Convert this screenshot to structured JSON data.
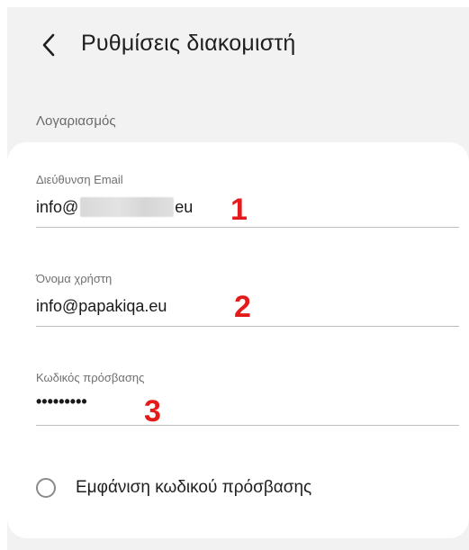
{
  "header": {
    "back_icon": "chevron-left-icon",
    "title": "Ρυθμίσεις διακομιστή"
  },
  "account": {
    "section_label": "Λογαριασμός",
    "email": {
      "label": "Διεύθυνση Email",
      "value_prefix": "info@",
      "value_suffix": "eu",
      "annotation": "1"
    },
    "username": {
      "label": "Όνομα χρήστη",
      "value": "info@papakiqa.eu",
      "annotation": "2"
    },
    "password": {
      "label": "Κωδικός πρόσβασης",
      "value": "•••••••••",
      "annotation": "3"
    },
    "show_password": {
      "label": "Εμφάνιση κωδικού πρόσβασης",
      "checked": false
    }
  },
  "colors": {
    "background": "#f2f2f2",
    "card": "#ffffff",
    "annotation": "#e31b1b",
    "divider": "#bdbdbd"
  }
}
